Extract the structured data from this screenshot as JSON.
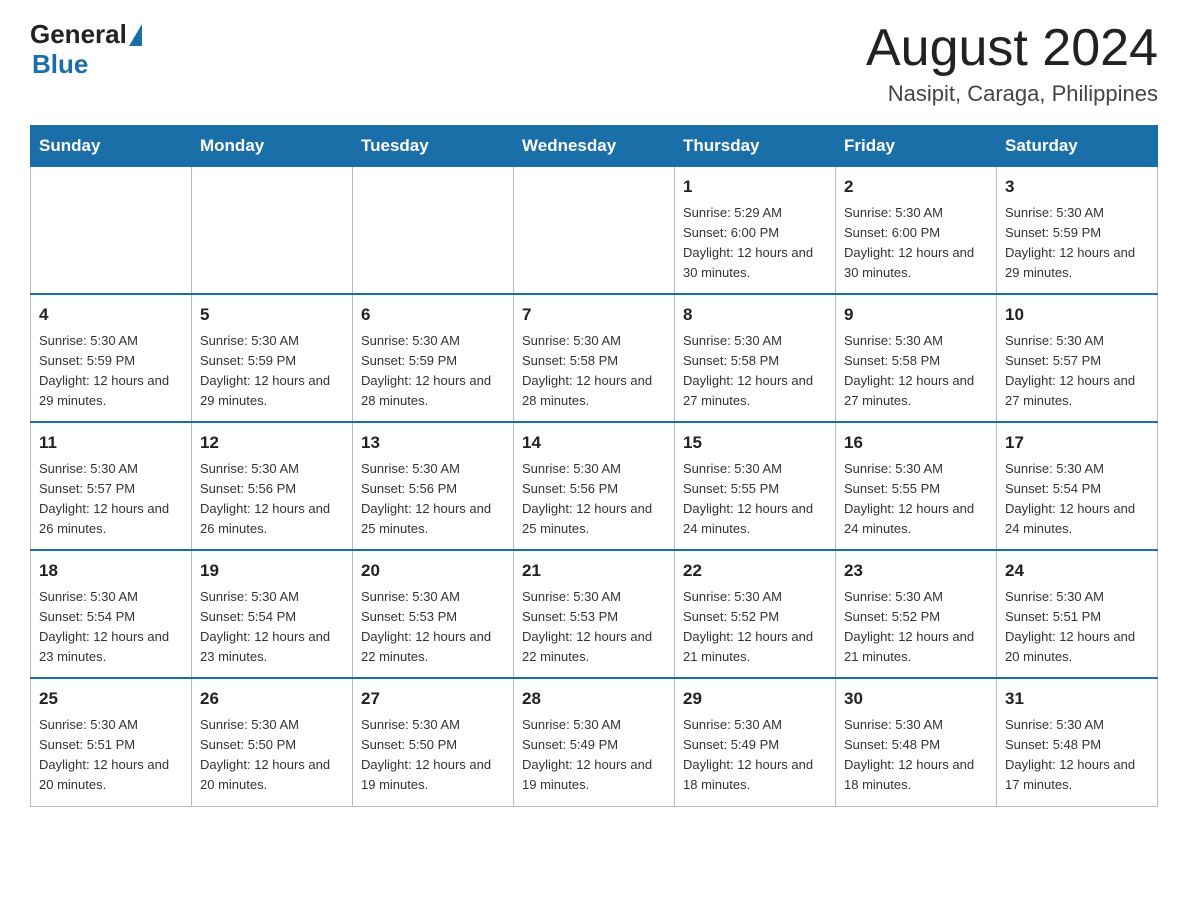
{
  "header": {
    "logo_general": "General",
    "logo_blue": "Blue",
    "month_title": "August 2024",
    "location": "Nasipit, Caraga, Philippines"
  },
  "weekdays": [
    "Sunday",
    "Monday",
    "Tuesday",
    "Wednesday",
    "Thursday",
    "Friday",
    "Saturday"
  ],
  "weeks": [
    [
      {
        "day": "",
        "info": ""
      },
      {
        "day": "",
        "info": ""
      },
      {
        "day": "",
        "info": ""
      },
      {
        "day": "",
        "info": ""
      },
      {
        "day": "1",
        "info": "Sunrise: 5:29 AM\nSunset: 6:00 PM\nDaylight: 12 hours and 30 minutes."
      },
      {
        "day": "2",
        "info": "Sunrise: 5:30 AM\nSunset: 6:00 PM\nDaylight: 12 hours and 30 minutes."
      },
      {
        "day": "3",
        "info": "Sunrise: 5:30 AM\nSunset: 5:59 PM\nDaylight: 12 hours and 29 minutes."
      }
    ],
    [
      {
        "day": "4",
        "info": "Sunrise: 5:30 AM\nSunset: 5:59 PM\nDaylight: 12 hours and 29 minutes."
      },
      {
        "day": "5",
        "info": "Sunrise: 5:30 AM\nSunset: 5:59 PM\nDaylight: 12 hours and 29 minutes."
      },
      {
        "day": "6",
        "info": "Sunrise: 5:30 AM\nSunset: 5:59 PM\nDaylight: 12 hours and 28 minutes."
      },
      {
        "day": "7",
        "info": "Sunrise: 5:30 AM\nSunset: 5:58 PM\nDaylight: 12 hours and 28 minutes."
      },
      {
        "day": "8",
        "info": "Sunrise: 5:30 AM\nSunset: 5:58 PM\nDaylight: 12 hours and 27 minutes."
      },
      {
        "day": "9",
        "info": "Sunrise: 5:30 AM\nSunset: 5:58 PM\nDaylight: 12 hours and 27 minutes."
      },
      {
        "day": "10",
        "info": "Sunrise: 5:30 AM\nSunset: 5:57 PM\nDaylight: 12 hours and 27 minutes."
      }
    ],
    [
      {
        "day": "11",
        "info": "Sunrise: 5:30 AM\nSunset: 5:57 PM\nDaylight: 12 hours and 26 minutes."
      },
      {
        "day": "12",
        "info": "Sunrise: 5:30 AM\nSunset: 5:56 PM\nDaylight: 12 hours and 26 minutes."
      },
      {
        "day": "13",
        "info": "Sunrise: 5:30 AM\nSunset: 5:56 PM\nDaylight: 12 hours and 25 minutes."
      },
      {
        "day": "14",
        "info": "Sunrise: 5:30 AM\nSunset: 5:56 PM\nDaylight: 12 hours and 25 minutes."
      },
      {
        "day": "15",
        "info": "Sunrise: 5:30 AM\nSunset: 5:55 PM\nDaylight: 12 hours and 24 minutes."
      },
      {
        "day": "16",
        "info": "Sunrise: 5:30 AM\nSunset: 5:55 PM\nDaylight: 12 hours and 24 minutes."
      },
      {
        "day": "17",
        "info": "Sunrise: 5:30 AM\nSunset: 5:54 PM\nDaylight: 12 hours and 24 minutes."
      }
    ],
    [
      {
        "day": "18",
        "info": "Sunrise: 5:30 AM\nSunset: 5:54 PM\nDaylight: 12 hours and 23 minutes."
      },
      {
        "day": "19",
        "info": "Sunrise: 5:30 AM\nSunset: 5:54 PM\nDaylight: 12 hours and 23 minutes."
      },
      {
        "day": "20",
        "info": "Sunrise: 5:30 AM\nSunset: 5:53 PM\nDaylight: 12 hours and 22 minutes."
      },
      {
        "day": "21",
        "info": "Sunrise: 5:30 AM\nSunset: 5:53 PM\nDaylight: 12 hours and 22 minutes."
      },
      {
        "day": "22",
        "info": "Sunrise: 5:30 AM\nSunset: 5:52 PM\nDaylight: 12 hours and 21 minutes."
      },
      {
        "day": "23",
        "info": "Sunrise: 5:30 AM\nSunset: 5:52 PM\nDaylight: 12 hours and 21 minutes."
      },
      {
        "day": "24",
        "info": "Sunrise: 5:30 AM\nSunset: 5:51 PM\nDaylight: 12 hours and 20 minutes."
      }
    ],
    [
      {
        "day": "25",
        "info": "Sunrise: 5:30 AM\nSunset: 5:51 PM\nDaylight: 12 hours and 20 minutes."
      },
      {
        "day": "26",
        "info": "Sunrise: 5:30 AM\nSunset: 5:50 PM\nDaylight: 12 hours and 20 minutes."
      },
      {
        "day": "27",
        "info": "Sunrise: 5:30 AM\nSunset: 5:50 PM\nDaylight: 12 hours and 19 minutes."
      },
      {
        "day": "28",
        "info": "Sunrise: 5:30 AM\nSunset: 5:49 PM\nDaylight: 12 hours and 19 minutes."
      },
      {
        "day": "29",
        "info": "Sunrise: 5:30 AM\nSunset: 5:49 PM\nDaylight: 12 hours and 18 minutes."
      },
      {
        "day": "30",
        "info": "Sunrise: 5:30 AM\nSunset: 5:48 PM\nDaylight: 12 hours and 18 minutes."
      },
      {
        "day": "31",
        "info": "Sunrise: 5:30 AM\nSunset: 5:48 PM\nDaylight: 12 hours and 17 minutes."
      }
    ]
  ]
}
